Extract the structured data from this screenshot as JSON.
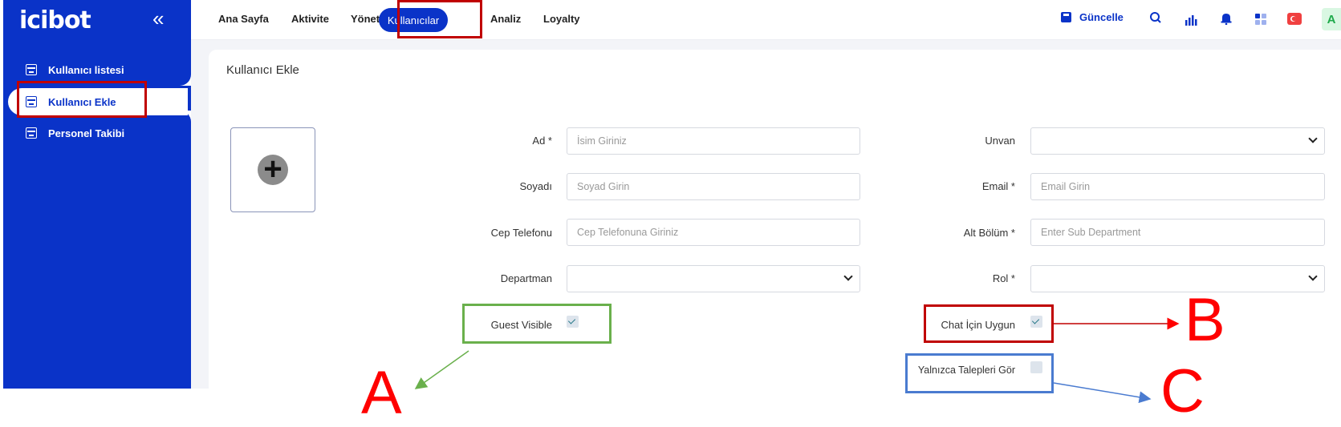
{
  "app": {
    "logo": "icibot",
    "collapse_icon": "double-chevron-left-icon"
  },
  "sidebar": {
    "items": [
      {
        "label": "Kullanıcı listesi",
        "icon": "calendar-icon",
        "active": false
      },
      {
        "label": "Kullanıcı Ekle",
        "icon": "calendar-icon",
        "active": true
      },
      {
        "label": "Personel Takibi",
        "icon": "calendar-icon",
        "active": false
      }
    ]
  },
  "topnav": {
    "items": [
      {
        "label": "Ana Sayfa",
        "active": false
      },
      {
        "label": "Aktivite",
        "active": false
      },
      {
        "label": "Yönetici",
        "active": false
      },
      {
        "label": "Kullanıcılar",
        "active": true
      },
      {
        "label": "Analiz",
        "active": false
      },
      {
        "label": "Loyalty",
        "active": false
      }
    ],
    "save_label": "Güncelle",
    "tools": [
      "search-icon",
      "bar-chart-icon",
      "bell-icon",
      "apps-grid-icon",
      "flag-tr-icon"
    ],
    "avatar_initial": "A"
  },
  "page": {
    "title": "Kullanıcı Ekle",
    "upload_icon": "plus-circle-icon"
  },
  "form": {
    "left": [
      {
        "label": "Ad *",
        "placeholder": "İsim Giriniz",
        "type": "text"
      },
      {
        "label": "Soyadı",
        "placeholder": "Soyad Girin",
        "type": "text"
      },
      {
        "label": "Cep Telefonu",
        "placeholder": "Cep Telefonuna Giriniz",
        "type": "text"
      },
      {
        "label": "Departman",
        "placeholder": "",
        "type": "select"
      }
    ],
    "right": [
      {
        "label": "Unvan",
        "placeholder": "",
        "type": "select"
      },
      {
        "label": "Email *",
        "placeholder": "Email Girin",
        "type": "text"
      },
      {
        "label": "Alt Bölüm *",
        "placeholder": "Enter Sub Department",
        "type": "text"
      },
      {
        "label": "Rol *",
        "placeholder": "",
        "type": "select"
      }
    ],
    "checkboxes": [
      {
        "label": "Guest Visible",
        "checked": true
      },
      {
        "label": "Chat İçin Uygun",
        "checked": true
      },
      {
        "label": "Yalnızca Talepleri Gör",
        "checked": false
      }
    ]
  },
  "annotations": {
    "letters": [
      "A",
      "B",
      "C"
    ],
    "colors": {
      "red": "#ff0000",
      "green": "#6ab04c",
      "blue": "#4a7bd0",
      "box_red": "#c00000"
    }
  }
}
